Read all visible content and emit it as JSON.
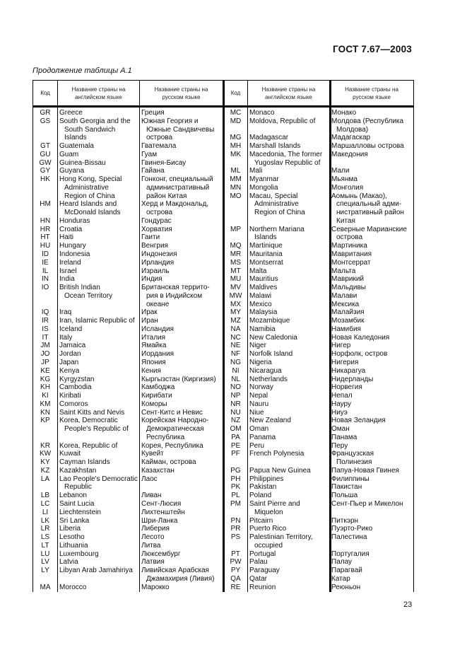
{
  "document": {
    "standard_code": "ГОСТ 7.67—2003",
    "caption": "Продолжение таблицы  А.1",
    "page_number": "23"
  },
  "table": {
    "headers": {
      "code": "Код",
      "name_en": "Название страны на английском языке",
      "name_ru": "Название страны на русском языке"
    },
    "left_rows": [
      {
        "code": "GR",
        "en": [
          "Greece"
        ],
        "ru": [
          "Греция"
        ]
      },
      {
        "code": "GS",
        "en": [
          "South Georgia and the",
          "South Sandwich",
          "Islands"
        ],
        "ru": [
          "Южная Георгия и",
          "Южные Сандвичевы",
          "острова"
        ]
      },
      {
        "code": "GT",
        "en": [
          "Guatemala"
        ],
        "ru": [
          "Гватемала"
        ]
      },
      {
        "code": "GU",
        "en": [
          "Guam"
        ],
        "ru": [
          "Гуам"
        ]
      },
      {
        "code": "GW",
        "en": [
          "Guinea-Bissau"
        ],
        "ru": [
          "Гвинея-Бисау"
        ]
      },
      {
        "code": "GY",
        "en": [
          "Guyana"
        ],
        "ru": [
          "Гайана"
        ]
      },
      {
        "code": "HK",
        "en": [
          "Hong Kong, Special",
          "Administrative",
          "Region of China"
        ],
        "ru": [
          "Гонконг, специальный",
          "административный",
          "район Китая"
        ]
      },
      {
        "code": "HM",
        "en": [
          "Heard Islands and",
          "McDonald Islands"
        ],
        "ru": [
          "Херд и Макдональд,",
          "острова"
        ]
      },
      {
        "code": "HN",
        "en": [
          "Honduras"
        ],
        "ru": [
          "Гондурас"
        ]
      },
      {
        "code": "HR",
        "en": [
          "Croatia"
        ],
        "ru": [
          "Хорватия"
        ]
      },
      {
        "code": "HT",
        "en": [
          "Haiti"
        ],
        "ru": [
          "Гаити"
        ]
      },
      {
        "code": "HU",
        "en": [
          "Hungary"
        ],
        "ru": [
          "Венгрия"
        ]
      },
      {
        "code": "ID",
        "en": [
          "Indonesia"
        ],
        "ru": [
          "Индонезия"
        ]
      },
      {
        "code": "IE",
        "en": [
          "Ireland"
        ],
        "ru": [
          "Ирландия"
        ]
      },
      {
        "code": "IL",
        "en": [
          "Israel"
        ],
        "ru": [
          "Израиль"
        ]
      },
      {
        "code": "IN",
        "en": [
          "India"
        ],
        "ru": [
          "Индия"
        ]
      },
      {
        "code": "IO",
        "en": [
          "British Indian",
          "Ocean Territory",
          ""
        ],
        "ru": [
          "Британская террито-",
          "рия в Индийском",
          "океане"
        ]
      },
      {
        "code": "IQ",
        "en": [
          "Iraq"
        ],
        "ru": [
          "Ирак"
        ]
      },
      {
        "code": "IR",
        "en": [
          "Iran, Islamic Republic of"
        ],
        "ru": [
          "Иран"
        ]
      },
      {
        "code": "IS",
        "en": [
          "Iceland"
        ],
        "ru": [
          "Исландия"
        ]
      },
      {
        "code": "IT",
        "en": [
          "Italy"
        ],
        "ru": [
          "Италия"
        ]
      },
      {
        "code": "JM",
        "en": [
          "Jamaica"
        ],
        "ru": [
          "Ямайка"
        ]
      },
      {
        "code": "JO",
        "en": [
          "Jordan"
        ],
        "ru": [
          "Иордания"
        ]
      },
      {
        "code": "JP",
        "en": [
          "Japan"
        ],
        "ru": [
          "Япония"
        ]
      },
      {
        "code": "KE",
        "en": [
          "Kenya"
        ],
        "ru": [
          "Кения"
        ]
      },
      {
        "code": "KG",
        "en": [
          "Kyrgyzstan"
        ],
        "ru": [
          "Кыргызстан (Киргизия)"
        ]
      },
      {
        "code": "KH",
        "en": [
          "Cambodia"
        ],
        "ru": [
          "Камбоджа"
        ]
      },
      {
        "code": "KI",
        "en": [
          "Kiribati"
        ],
        "ru": [
          "Кирибати"
        ]
      },
      {
        "code": "KM",
        "en": [
          "Comoros"
        ],
        "ru": [
          "Коморы"
        ]
      },
      {
        "code": "KN",
        "en": [
          "Saint Kitts and Nevis"
        ],
        "ru": [
          "Сент-Китс и Невис"
        ]
      },
      {
        "code": "KP",
        "en": [
          "Korea, Democratic",
          "People's Republic of",
          ""
        ],
        "ru": [
          "Корейская Народно-",
          "Демократическая",
          "Республика"
        ]
      },
      {
        "code": "KR",
        "en": [
          "Korea, Republic of"
        ],
        "ru": [
          "Корея, Республика"
        ]
      },
      {
        "code": "KW",
        "en": [
          "Kuwait"
        ],
        "ru": [
          "Кувейт"
        ]
      },
      {
        "code": "KY",
        "en": [
          "Cayman Islands"
        ],
        "ru": [
          "Кайман, острова"
        ]
      },
      {
        "code": "KZ",
        "en": [
          "Kazakhstan"
        ],
        "ru": [
          "Казахстан"
        ]
      },
      {
        "code": "LA",
        "en": [
          "Lao People's Democratic",
          "Republic"
        ],
        "ru": [
          "Лаос",
          ""
        ]
      },
      {
        "code": "LB",
        "en": [
          "Lebanon"
        ],
        "ru": [
          "Ливан"
        ]
      },
      {
        "code": "LC",
        "en": [
          "Saint Lucia"
        ],
        "ru": [
          "Сент-Люсия"
        ]
      },
      {
        "code": "LI",
        "en": [
          "Liechtenstein"
        ],
        "ru": [
          "Лихтенштейн"
        ]
      },
      {
        "code": "LK",
        "en": [
          "Sri Lanka"
        ],
        "ru": [
          "Шри-Ланка"
        ]
      },
      {
        "code": "LR",
        "en": [
          "Liberia"
        ],
        "ru": [
          "Либерия"
        ]
      },
      {
        "code": "LS",
        "en": [
          "Lesotho"
        ],
        "ru": [
          "Лесото"
        ]
      },
      {
        "code": "LT",
        "en": [
          "Lithuania"
        ],
        "ru": [
          "Литва"
        ]
      },
      {
        "code": "LU",
        "en": [
          "Luxembourg"
        ],
        "ru": [
          "Люксембург"
        ]
      },
      {
        "code": "LV",
        "en": [
          "Latvia"
        ],
        "ru": [
          "Латвия"
        ]
      },
      {
        "code": "LY",
        "en": [
          "Libyan Arab Jamahiriya",
          ""
        ],
        "ru": [
          "Ливийская Арабская",
          "Джамахирия (Ливия)"
        ]
      },
      {
        "code": "MA",
        "en": [
          "Morocco"
        ],
        "ru": [
          "Марокко"
        ]
      }
    ],
    "right_rows": [
      {
        "code": "MC",
        "en": [
          "Monaco"
        ],
        "ru": [
          "Монако"
        ]
      },
      {
        "code": "MD",
        "en": [
          "Moldova, Republic of",
          ""
        ],
        "ru": [
          "Молдова (Республика",
          "Молдова)"
        ]
      },
      {
        "code": "MG",
        "en": [
          "Madagascar"
        ],
        "ru": [
          "Мадагаскар"
        ]
      },
      {
        "code": "MH",
        "en": [
          "Marshall Islands"
        ],
        "ru": [
          "Маршалловы острова"
        ]
      },
      {
        "code": "MK",
        "en": [
          "Macedonia, The former",
          "Yugoslav Republic of"
        ],
        "ru": [
          "Македония",
          ""
        ]
      },
      {
        "code": "ML",
        "en": [
          "Mali"
        ],
        "ru": [
          "Мали"
        ]
      },
      {
        "code": "MM",
        "en": [
          "Myanmar"
        ],
        "ru": [
          "Мьянма"
        ]
      },
      {
        "code": "MN",
        "en": [
          "Mongolia"
        ],
        "ru": [
          "Монголия"
        ]
      },
      {
        "code": "MO",
        "en": [
          "Macau, Special",
          "Administrative",
          "Region of China",
          ""
        ],
        "ru": [
          "Аомынь (Макао),",
          "специальный адми-",
          "нистративный район",
          "Китая"
        ]
      },
      {
        "code": "MP",
        "en": [
          "Northern Mariana",
          "Islands"
        ],
        "ru": [
          "Северные Марианские",
          "острова"
        ]
      },
      {
        "code": "MQ",
        "en": [
          "Martinique"
        ],
        "ru": [
          "Мартиника"
        ]
      },
      {
        "code": "MR",
        "en": [
          "Mauritania"
        ],
        "ru": [
          "Мавритания"
        ]
      },
      {
        "code": "MS",
        "en": [
          "Montserrat"
        ],
        "ru": [
          "Монтсеррат"
        ]
      },
      {
        "code": "MT",
        "en": [
          "Malta"
        ],
        "ru": [
          "Мальта"
        ]
      },
      {
        "code": "MU",
        "en": [
          "Mauritius"
        ],
        "ru": [
          "Маврикий"
        ]
      },
      {
        "code": "MV",
        "en": [
          "Maldives"
        ],
        "ru": [
          "Мальдивы"
        ]
      },
      {
        "code": "MW",
        "en": [
          "Malawi"
        ],
        "ru": [
          "Малави"
        ]
      },
      {
        "code": "MX",
        "en": [
          "Mexico"
        ],
        "ru": [
          "Мексика"
        ]
      },
      {
        "code": "MY",
        "en": [
          "Malaysia"
        ],
        "ru": [
          "Малайзия"
        ]
      },
      {
        "code": "MZ",
        "en": [
          "Mozambique"
        ],
        "ru": [
          "Мозамбик"
        ]
      },
      {
        "code": "NA",
        "en": [
          "Namibia"
        ],
        "ru": [
          "Намибия"
        ]
      },
      {
        "code": "NC",
        "en": [
          "New Caledonia"
        ],
        "ru": [
          "Новая Каледония"
        ]
      },
      {
        "code": "NE",
        "en": [
          "Niger"
        ],
        "ru": [
          "Нигер"
        ]
      },
      {
        "code": "NF",
        "en": [
          "Norfolk Island"
        ],
        "ru": [
          "Норфолк, остров"
        ]
      },
      {
        "code": "NG",
        "en": [
          "Nigeria"
        ],
        "ru": [
          "Нигерия"
        ]
      },
      {
        "code": "NI",
        "en": [
          "Nicaragua"
        ],
        "ru": [
          "Никарагуа"
        ]
      },
      {
        "code": "NL",
        "en": [
          "Netherlands"
        ],
        "ru": [
          "Нидерланды"
        ]
      },
      {
        "code": "NO",
        "en": [
          "Norway"
        ],
        "ru": [
          "Норвегия"
        ]
      },
      {
        "code": "NP",
        "en": [
          "Nepal"
        ],
        "ru": [
          "Непал"
        ]
      },
      {
        "code": "NR",
        "en": [
          "Nauru"
        ],
        "ru": [
          "Науру"
        ]
      },
      {
        "code": "NU",
        "en": [
          "Niue"
        ],
        "ru": [
          "Ниуэ"
        ]
      },
      {
        "code": "NZ",
        "en": [
          "New Zealand"
        ],
        "ru": [
          "Новая Зеландия"
        ]
      },
      {
        "code": "OM",
        "en": [
          "Oman"
        ],
        "ru": [
          "Оман"
        ]
      },
      {
        "code": "PA",
        "en": [
          "Panama"
        ],
        "ru": [
          "Панама"
        ]
      },
      {
        "code": "PE",
        "en": [
          "Peru"
        ],
        "ru": [
          "Перу"
        ]
      },
      {
        "code": "PF",
        "en": [
          "French Polynesia",
          ""
        ],
        "ru": [
          "Французская",
          "Полинезия"
        ]
      },
      {
        "code": "PG",
        "en": [
          "Papua New Guinea"
        ],
        "ru": [
          "Папуа-Новая Гвинея"
        ]
      },
      {
        "code": "PH",
        "en": [
          "Philippines"
        ],
        "ru": [
          "Филиппины"
        ]
      },
      {
        "code": "PK",
        "en": [
          "Pakistan"
        ],
        "ru": [
          "Пакистан"
        ]
      },
      {
        "code": "PL",
        "en": [
          "Poland"
        ],
        "ru": [
          "Польша"
        ]
      },
      {
        "code": "PM",
        "en": [
          "Saint Pierre and",
          "Miquelon"
        ],
        "ru": [
          "Сент-Пьер и Микелон",
          ""
        ]
      },
      {
        "code": "PN",
        "en": [
          "Pitcairn"
        ],
        "ru": [
          "Питкэрн"
        ]
      },
      {
        "code": "PR",
        "en": [
          "Puerto Rico"
        ],
        "ru": [
          "Пуэрто-Рико"
        ]
      },
      {
        "code": "PS",
        "en": [
          "Palestinian Territory,",
          "occupied"
        ],
        "ru": [
          "Палестина",
          ""
        ]
      },
      {
        "code": "PT",
        "en": [
          "Portugal"
        ],
        "ru": [
          "Португалия"
        ]
      },
      {
        "code": "PW",
        "en": [
          "Palau"
        ],
        "ru": [
          "Палау"
        ]
      },
      {
        "code": "PY",
        "en": [
          "Paraguay"
        ],
        "ru": [
          "Парагвай"
        ]
      },
      {
        "code": "QA",
        "en": [
          "Qatar"
        ],
        "ru": [
          "Катар"
        ]
      },
      {
        "code": "RE",
        "en": [
          "Reunion"
        ],
        "ru": [
          "Реюньон"
        ]
      }
    ]
  }
}
